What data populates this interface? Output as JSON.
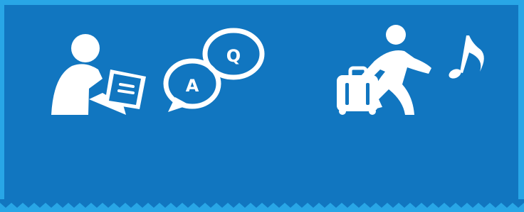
{
  "icons": {
    "writer": "person-writing-icon",
    "qa_bubbles": "qa-speech-bubbles-icon",
    "traveler": "walking-traveler-icon",
    "suitcase": "suitcase-icon",
    "music_note": "music-note-icon"
  },
  "qa": {
    "question_letter": "Q",
    "answer_letter": "A"
  },
  "colors": {
    "frame": "#28a6e6",
    "panel": "#1176c0",
    "icon": "#ffffff"
  }
}
